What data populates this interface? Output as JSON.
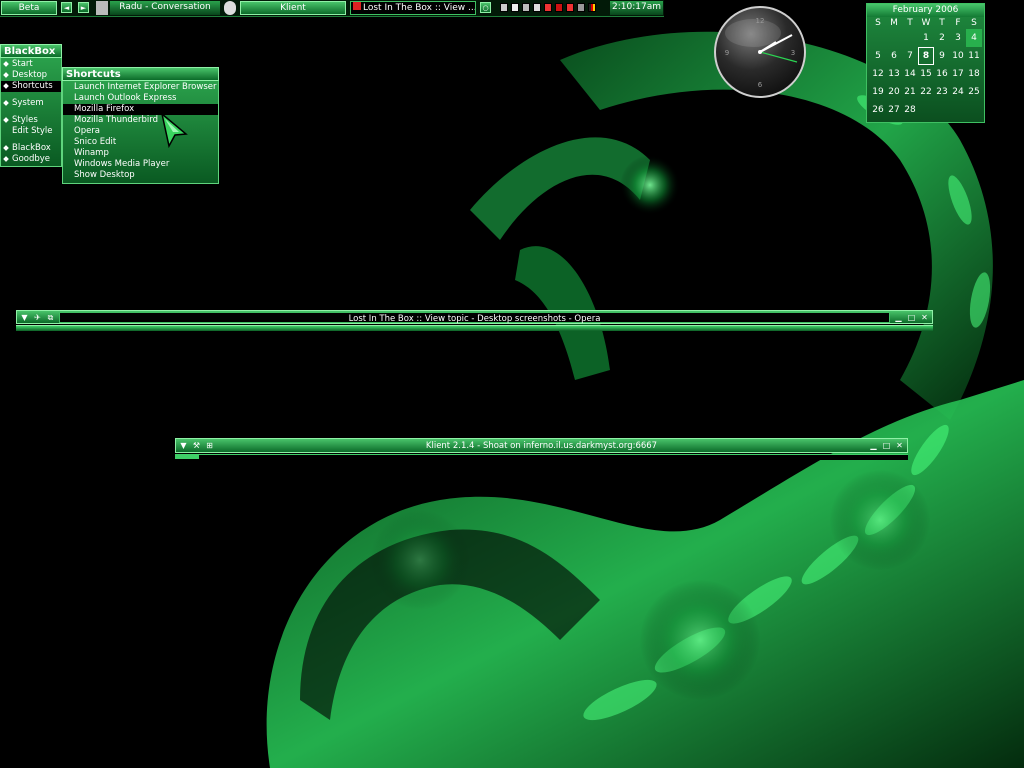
{
  "toolbar": {
    "workspace": "Beta",
    "window_label": "Radu - Conversation",
    "app_label": "Klient",
    "task_label": "Lost In The Box :: View ...",
    "time": "2:10:17am"
  },
  "blackbox_menu": {
    "title": "BlackBox",
    "items": [
      "Start",
      "Desktop",
      "Shortcuts",
      "System",
      "Styles",
      "Edit Style",
      "BlackBox",
      "Goodbye"
    ]
  },
  "shortcuts_menu": {
    "title": "Shortcuts",
    "items": [
      "Launch Internet Explorer Browser",
      "Launch Outlook Express",
      "Mozilla Firefox",
      "Mozilla Thunderbird",
      "Opera",
      "Snico Edit",
      "Winamp",
      "Windows Media Player",
      "Show Desktop"
    ]
  },
  "windows": {
    "opera_title": "Lost In The Box :: View topic - Desktop screenshots - Opera",
    "klient_title": "Klient 2.1.4 - Shoat on inferno.il.us.darkmyst.org:6667"
  },
  "calendar": {
    "title": "February 2006",
    "weekdays": [
      "S",
      "M",
      "T",
      "W",
      "T",
      "F",
      "S"
    ],
    "rows": [
      [
        "",
        "",
        "",
        "1",
        "2",
        "3",
        "4"
      ],
      [
        "5",
        "6",
        "7",
        "8",
        "9",
        "10",
        "11"
      ],
      [
        "12",
        "13",
        "14",
        "15",
        "16",
        "17",
        "18"
      ],
      [
        "19",
        "20",
        "21",
        "22",
        "23",
        "24",
        "25"
      ],
      [
        "26",
        "27",
        "28",
        "",
        "",
        "",
        ""
      ]
    ],
    "today": "8",
    "highlighted": "4"
  },
  "clock": {
    "numerals": [
      "12",
      "3",
      "6",
      "9"
    ]
  },
  "colors": {
    "accent": "#1f9e45",
    "highlight": "#28b04d",
    "text": "#ffffff",
    "background": "#000000"
  }
}
